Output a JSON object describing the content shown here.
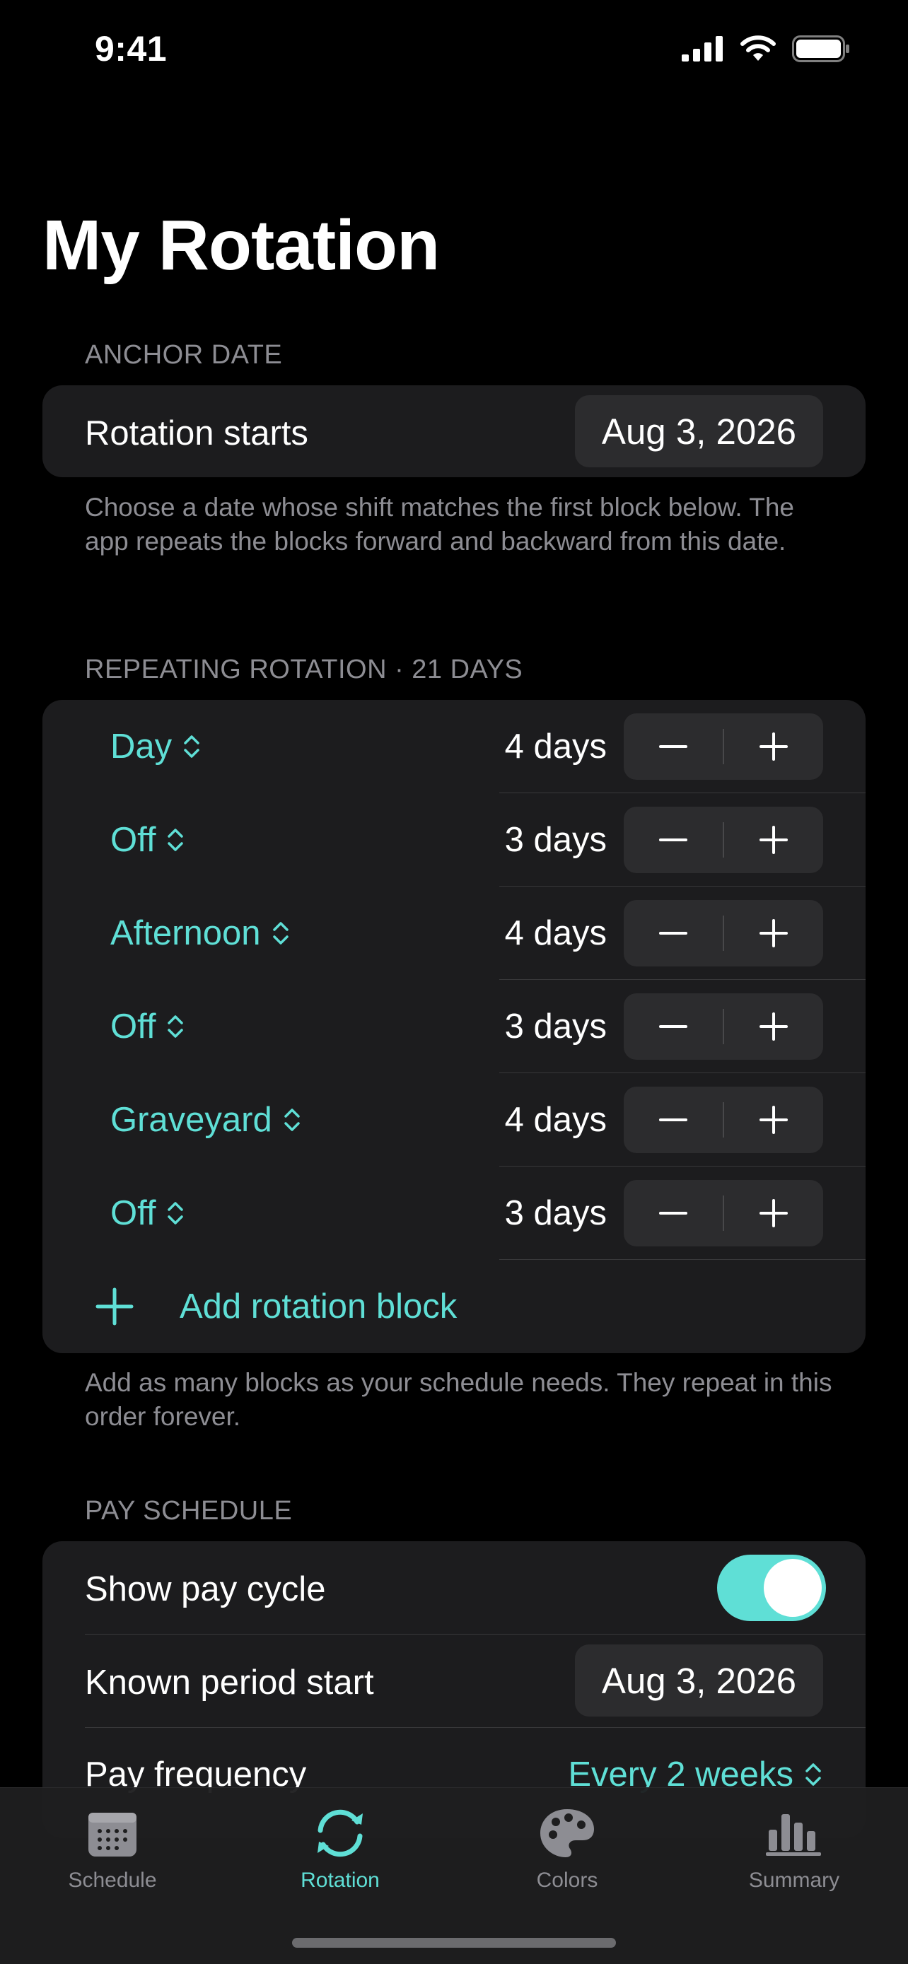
{
  "status_bar": {
    "time": "9:41"
  },
  "page": {
    "title": "My Rotation"
  },
  "anchor": {
    "header": "ANCHOR DATE",
    "label": "Rotation starts",
    "date": "Aug 3, 2026",
    "footer": "Choose a date whose shift matches the first block below. The app repeats the blocks forward and backward from this date."
  },
  "rotation": {
    "header": "REPEATING ROTATION · 21 DAYS",
    "blocks": [
      {
        "shift": "Day",
        "days": "4 days"
      },
      {
        "shift": "Off",
        "days": "3 days"
      },
      {
        "shift": "Afternoon",
        "days": "4 days"
      },
      {
        "shift": "Off",
        "days": "3 days"
      },
      {
        "shift": "Graveyard",
        "days": "4 days"
      },
      {
        "shift": "Off",
        "days": "3 days"
      }
    ],
    "add_label": "Add rotation block",
    "footer": "Add as many blocks as your schedule needs. They repeat in this order forever."
  },
  "pay": {
    "header": "PAY SCHEDULE",
    "show_label": "Show pay cycle",
    "show_enabled": true,
    "period_label": "Known period start",
    "period_date": "Aug 3, 2026",
    "frequency_label": "Pay frequency",
    "frequency_value": "Every 2 weeks"
  },
  "tabs": [
    {
      "label": "Schedule",
      "icon": "calendar-icon",
      "active": false
    },
    {
      "label": "Rotation",
      "icon": "rotation-arrows-icon",
      "active": true
    },
    {
      "label": "Colors",
      "icon": "palette-icon",
      "active": false
    },
    {
      "label": "Summary",
      "icon": "chart-bars-icon",
      "active": false
    }
  ],
  "colors": {
    "accent": "#5fdfd6",
    "card": "#1c1c1e",
    "secondary_text": "#8d8d93"
  }
}
